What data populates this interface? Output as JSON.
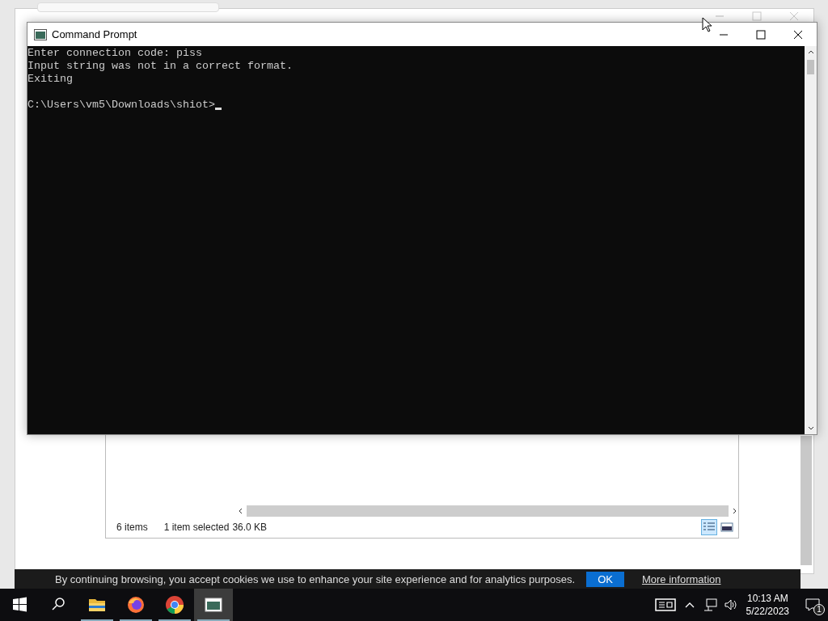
{
  "browser": {
    "cookie_banner": {
      "text": "By continuing browsing, you accept cookies we use to enhance your site experience and for analytics purposes.",
      "ok": "OK",
      "link": "More information"
    }
  },
  "explorer": {
    "status": {
      "items": "6 items",
      "selected": "1 item selected",
      "size": "36.0 KB"
    },
    "views": [
      {
        "kind": "details",
        "selected": true
      },
      {
        "kind": "preview",
        "selected": false
      }
    ]
  },
  "cmd": {
    "title": "Command Prompt",
    "lines": [
      "Enter connection code: piss",
      "Input string was not in a correct format.",
      "Exiting"
    ],
    "prompt": "C:\\Users\\vm5\\Downloads\\shiot>"
  },
  "taskbar": {
    "apps": [
      {
        "kind": "folder",
        "selected": false
      },
      {
        "kind": "firefox",
        "selected": false
      },
      {
        "kind": "chrome",
        "selected": false
      },
      {
        "kind": "console",
        "selected": true
      }
    ],
    "time": "10:13 AM",
    "date": "5/22/2023",
    "notifications": "1"
  }
}
